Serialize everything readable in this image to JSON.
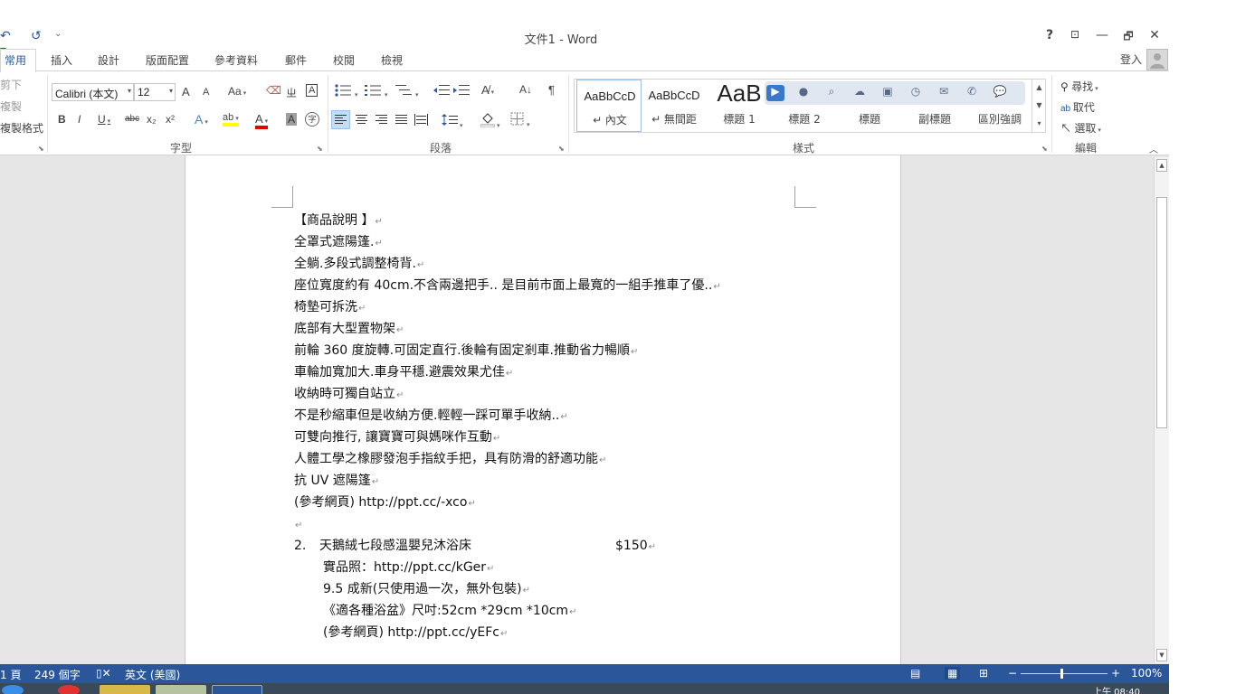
{
  "window": {
    "title": "文件1 - Word",
    "help": "?",
    "ribbon_display": "⊡",
    "minimize": "—",
    "restore": "🗗",
    "close": "✕"
  },
  "qat": {
    "undo": "↶ ▾",
    "redo": "↺",
    "customize": "⌄"
  },
  "tabs": [
    "常用",
    "插入",
    "設計",
    "版面配置",
    "參考資料",
    "郵件",
    "校閱",
    "檢視"
  ],
  "signin": "登入",
  "clipboard": {
    "cut": "剪下",
    "copy": "複製",
    "format_painter": "複製格式"
  },
  "font": {
    "name": "Calibri (本文)",
    "size": "12",
    "group_label": "字型",
    "grow": "A",
    "shrink": "A",
    "case": "Aa",
    "clear": "⌫",
    "phonetic": "ㄓ",
    "border": "A",
    "bold": "B",
    "italic": "I",
    "underline": "U",
    "strike": "abc",
    "subscript": "x₂",
    "superscript": "x²",
    "effects": "A",
    "highlight": "ab",
    "color": "A",
    "shade": "A",
    "enclose": "字"
  },
  "paragraph": {
    "group_label": "段落"
  },
  "styles": {
    "group_label": "樣式",
    "items": [
      {
        "sample": "AaBbCcD",
        "name": "↵ 內文"
      },
      {
        "sample": "AaBbCcD",
        "name": "↵ 無間距"
      },
      {
        "sample": "AaB",
        "name": "標題 1"
      },
      {
        "sample": "",
        "name": "標題 2"
      },
      {
        "sample": "",
        "name": "標題"
      },
      {
        "sample": "",
        "name": "副標題"
      },
      {
        "sample": "",
        "name": "區別強調"
      }
    ]
  },
  "editing": {
    "find": "尋找",
    "replace": "取代",
    "select": "選取",
    "group_label": "編輯"
  },
  "document": {
    "lines": [
      "【商品說明 】",
      "全罩式遮陽篷.",
      "全躺.多段式調整椅背.",
      "座位寬度約有 40cm.不含兩邊把手.. 是目前市面上最寬的一組手推車了優..",
      "椅墊可拆洗",
      "底部有大型置物架",
      "前輪 360 度旋轉.可固定直行.後輪有固定剎車.推動省力暢順",
      "車輪加寬加大.車身平穩.避震效果尤佳",
      "收納時可獨自站立",
      "不是秒縮車但是收納方便.輕輕一踩可單手收納..",
      "可雙向推行, 讓寶寶可與媽咪作互動",
      "人體工學之橡膠發泡手指紋手把，具有防滑的舒適功能",
      "抗 UV 遮陽篷",
      "(參考網頁) http://ppt.cc/-xco",
      ""
    ],
    "item2": {
      "number": "2.",
      "title": "天鵝絨七段感溫嬰兒沐浴床",
      "price": "$150",
      "sub": [
        "實品照：http://ppt.cc/kGer",
        "9.5 成新(只使用過一次，無外包裝)",
        "《適各種浴盆》尺吋:52cm *29cm *10cm",
        "(參考網頁) http://ppt.cc/yEFc"
      ]
    }
  },
  "status": {
    "page": "1 頁",
    "words": "249 個字",
    "language": "英文 (美國)",
    "zoom": "100%"
  },
  "taskbar": {
    "clock": "上午 08:40"
  }
}
